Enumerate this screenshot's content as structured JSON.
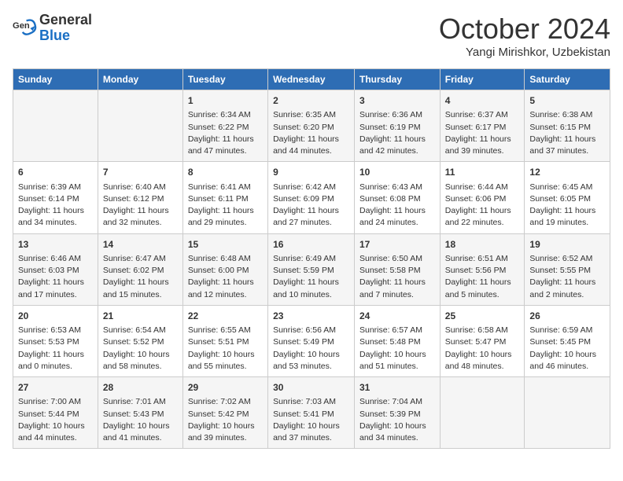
{
  "header": {
    "logo_general": "General",
    "logo_blue": "Blue",
    "month": "October 2024",
    "location": "Yangi Mirishkor, Uzbekistan"
  },
  "weekdays": [
    "Sunday",
    "Monday",
    "Tuesday",
    "Wednesday",
    "Thursday",
    "Friday",
    "Saturday"
  ],
  "weeks": [
    [
      {
        "day": "",
        "info": ""
      },
      {
        "day": "",
        "info": ""
      },
      {
        "day": "1",
        "info": "Sunrise: 6:34 AM\nSunset: 6:22 PM\nDaylight: 11 hours and 47 minutes."
      },
      {
        "day": "2",
        "info": "Sunrise: 6:35 AM\nSunset: 6:20 PM\nDaylight: 11 hours and 44 minutes."
      },
      {
        "day": "3",
        "info": "Sunrise: 6:36 AM\nSunset: 6:19 PM\nDaylight: 11 hours and 42 minutes."
      },
      {
        "day": "4",
        "info": "Sunrise: 6:37 AM\nSunset: 6:17 PM\nDaylight: 11 hours and 39 minutes."
      },
      {
        "day": "5",
        "info": "Sunrise: 6:38 AM\nSunset: 6:15 PM\nDaylight: 11 hours and 37 minutes."
      }
    ],
    [
      {
        "day": "6",
        "info": "Sunrise: 6:39 AM\nSunset: 6:14 PM\nDaylight: 11 hours and 34 minutes."
      },
      {
        "day": "7",
        "info": "Sunrise: 6:40 AM\nSunset: 6:12 PM\nDaylight: 11 hours and 32 minutes."
      },
      {
        "day": "8",
        "info": "Sunrise: 6:41 AM\nSunset: 6:11 PM\nDaylight: 11 hours and 29 minutes."
      },
      {
        "day": "9",
        "info": "Sunrise: 6:42 AM\nSunset: 6:09 PM\nDaylight: 11 hours and 27 minutes."
      },
      {
        "day": "10",
        "info": "Sunrise: 6:43 AM\nSunset: 6:08 PM\nDaylight: 11 hours and 24 minutes."
      },
      {
        "day": "11",
        "info": "Sunrise: 6:44 AM\nSunset: 6:06 PM\nDaylight: 11 hours and 22 minutes."
      },
      {
        "day": "12",
        "info": "Sunrise: 6:45 AM\nSunset: 6:05 PM\nDaylight: 11 hours and 19 minutes."
      }
    ],
    [
      {
        "day": "13",
        "info": "Sunrise: 6:46 AM\nSunset: 6:03 PM\nDaylight: 11 hours and 17 minutes."
      },
      {
        "day": "14",
        "info": "Sunrise: 6:47 AM\nSunset: 6:02 PM\nDaylight: 11 hours and 15 minutes."
      },
      {
        "day": "15",
        "info": "Sunrise: 6:48 AM\nSunset: 6:00 PM\nDaylight: 11 hours and 12 minutes."
      },
      {
        "day": "16",
        "info": "Sunrise: 6:49 AM\nSunset: 5:59 PM\nDaylight: 11 hours and 10 minutes."
      },
      {
        "day": "17",
        "info": "Sunrise: 6:50 AM\nSunset: 5:58 PM\nDaylight: 11 hours and 7 minutes."
      },
      {
        "day": "18",
        "info": "Sunrise: 6:51 AM\nSunset: 5:56 PM\nDaylight: 11 hours and 5 minutes."
      },
      {
        "day": "19",
        "info": "Sunrise: 6:52 AM\nSunset: 5:55 PM\nDaylight: 11 hours and 2 minutes."
      }
    ],
    [
      {
        "day": "20",
        "info": "Sunrise: 6:53 AM\nSunset: 5:53 PM\nDaylight: 11 hours and 0 minutes."
      },
      {
        "day": "21",
        "info": "Sunrise: 6:54 AM\nSunset: 5:52 PM\nDaylight: 10 hours and 58 minutes."
      },
      {
        "day": "22",
        "info": "Sunrise: 6:55 AM\nSunset: 5:51 PM\nDaylight: 10 hours and 55 minutes."
      },
      {
        "day": "23",
        "info": "Sunrise: 6:56 AM\nSunset: 5:49 PM\nDaylight: 10 hours and 53 minutes."
      },
      {
        "day": "24",
        "info": "Sunrise: 6:57 AM\nSunset: 5:48 PM\nDaylight: 10 hours and 51 minutes."
      },
      {
        "day": "25",
        "info": "Sunrise: 6:58 AM\nSunset: 5:47 PM\nDaylight: 10 hours and 48 minutes."
      },
      {
        "day": "26",
        "info": "Sunrise: 6:59 AM\nSunset: 5:45 PM\nDaylight: 10 hours and 46 minutes."
      }
    ],
    [
      {
        "day": "27",
        "info": "Sunrise: 7:00 AM\nSunset: 5:44 PM\nDaylight: 10 hours and 44 minutes."
      },
      {
        "day": "28",
        "info": "Sunrise: 7:01 AM\nSunset: 5:43 PM\nDaylight: 10 hours and 41 minutes."
      },
      {
        "day": "29",
        "info": "Sunrise: 7:02 AM\nSunset: 5:42 PM\nDaylight: 10 hours and 39 minutes."
      },
      {
        "day": "30",
        "info": "Sunrise: 7:03 AM\nSunset: 5:41 PM\nDaylight: 10 hours and 37 minutes."
      },
      {
        "day": "31",
        "info": "Sunrise: 7:04 AM\nSunset: 5:39 PM\nDaylight: 10 hours and 34 minutes."
      },
      {
        "day": "",
        "info": ""
      },
      {
        "day": "",
        "info": ""
      }
    ]
  ]
}
